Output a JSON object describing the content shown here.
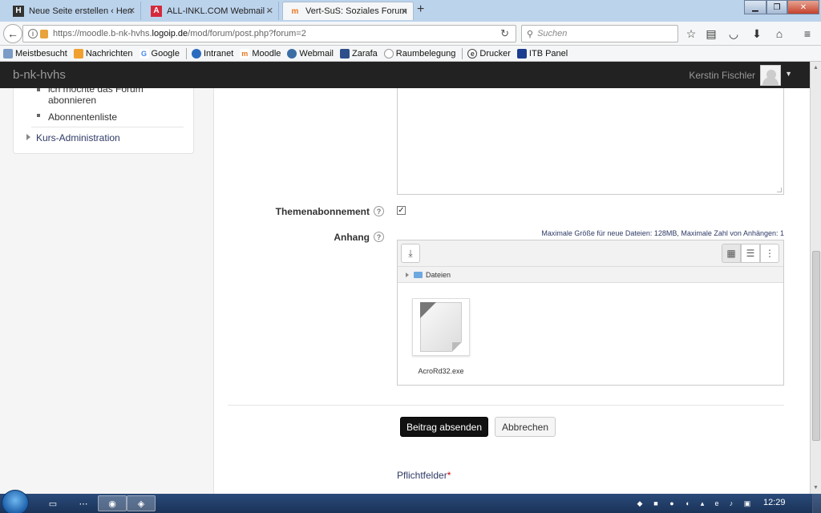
{
  "browser": {
    "tabs": [
      {
        "title": "Neue Seite erstellen ‹ Herm...",
        "favicon": "H"
      },
      {
        "title": "ALL-INKL.COM Webmail - ...",
        "favicon": "A"
      },
      {
        "title": "Vert-SuS: Soziales Forum: ...",
        "favicon": "m"
      }
    ],
    "url_prefix": "https://moodle.b-nk-hvhs.",
    "url_domain": "logoip.de",
    "url_suffix": "/mod/forum/post.php?forum=2",
    "search_placeholder": "Suchen",
    "bookmarks": [
      "Meistbesucht",
      "Nachrichten",
      "Google",
      "Intranet",
      "Moodle",
      "Webmail",
      "Zarafa",
      "Raumbelegung",
      "Drucker",
      "ITB Panel"
    ]
  },
  "moodle": {
    "brand": "b-nk-hvhs",
    "user_name": "Kerstin Fischler"
  },
  "sidebar": {
    "item_subscribe_line1": "ich möchte das Forum",
    "item_subscribe_line2": "abonnieren",
    "item_subscribers": "Abonnentenliste",
    "course_admin": "Kurs-Administration"
  },
  "form": {
    "subscription_label": "Themenabonnement",
    "subscription_checked": true,
    "attachment_label": "Anhang",
    "max_info": "Maximale Größe für neue Dateien: 128MB, Maximale Zahl von Anhängen: 1",
    "folder_label": "Dateien",
    "file_name": "AcroRd32.exe",
    "submit_label": "Beitrag absenden",
    "cancel_label": "Abbrechen",
    "required_label": "Pflichtfelder",
    "required_star": "*"
  },
  "taskbar": {
    "clock": "12:29"
  },
  "colors": {
    "header_bg": "#222222",
    "submit_bg": "#111111",
    "link": "#2f3a66"
  }
}
